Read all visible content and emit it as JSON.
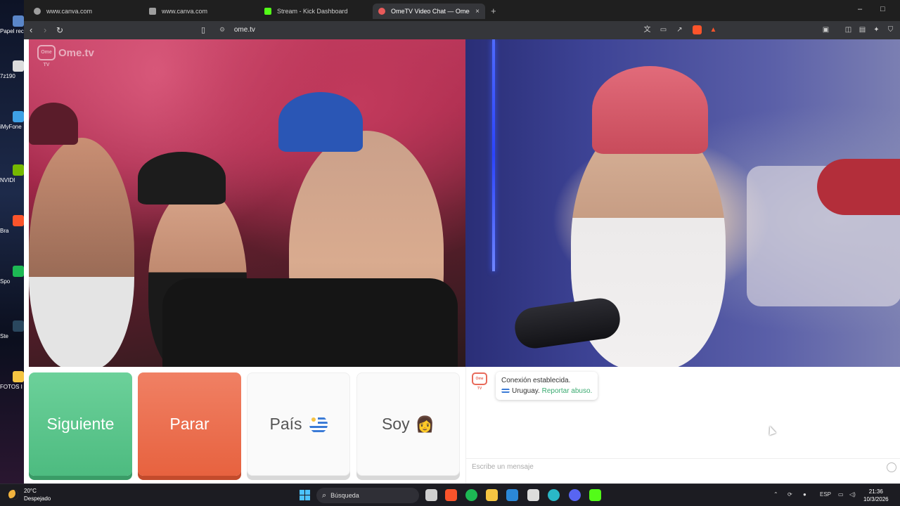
{
  "desktop": {
    "icons": [
      {
        "label": "Papel recic",
        "color": "#5a86c9"
      },
      {
        "label": "7z190",
        "color": "#dcdcdc"
      },
      {
        "label": "iMyFone",
        "color": "#3ea0e5"
      },
      {
        "label": "NVIDI",
        "color": "#76b900"
      },
      {
        "label": "Bra",
        "color": "#fb542b"
      },
      {
        "label": "Spo",
        "color": "#1db954"
      },
      {
        "label": "Ste",
        "color": "#2a475e"
      },
      {
        "label": "FOTOS I",
        "color": "#f5c542"
      }
    ]
  },
  "browser": {
    "tabs": [
      {
        "title": "www.canva.com",
        "favicon_color": "#9e9e9e",
        "active": false
      },
      {
        "title": "www.canva.com",
        "favicon_color": "#9e9e9e",
        "active": false
      },
      {
        "title": "Stream - Kick Dashboard",
        "favicon_color": "#53fc18",
        "active": false
      },
      {
        "title": "OmeTV Video Chat — Omeg",
        "favicon_color": "#e85a5a",
        "active": true
      }
    ],
    "new_tab_symbol": "+",
    "close_symbol": "×",
    "window_controls": {
      "minimize": "–",
      "maximize": "□"
    },
    "url": "ome.tv"
  },
  "ometv": {
    "watermark": "Ome.tv",
    "logo_text": "Ome TV",
    "buttons": {
      "next": "Siguiente",
      "stop": "Parar",
      "country": "País",
      "gender": "Soy"
    },
    "gender_emoji": "👩",
    "chat": {
      "status": "Conexión establecida.",
      "country": "Uruguay.",
      "report_link": "Reportar abuso.",
      "input_placeholder": "Escribe un mensaje"
    },
    "colors": {
      "next": "#4dbb80",
      "stop": "#e7623f",
      "link": "#3aaa70"
    }
  },
  "taskbar": {
    "weather": {
      "temp": "20°C",
      "condition": "Despejado"
    },
    "search_placeholder": "Búsqueda",
    "language": "ESP",
    "time": "21:36",
    "date": "10/3/2026",
    "pinned_apps": [
      {
        "name": "task-view-icon",
        "color": "#cfcfcf"
      },
      {
        "name": "brave-icon",
        "color": "#fb542b"
      },
      {
        "name": "spotify-icon",
        "color": "#1db954"
      },
      {
        "name": "file-explorer-icon",
        "color": "#f5c542"
      },
      {
        "name": "mail-icon",
        "color": "#2b88d8"
      },
      {
        "name": "store-icon",
        "color": "#dcdcdc"
      },
      {
        "name": "edge-icon",
        "color": "#2ab7c6"
      },
      {
        "name": "discord-icon",
        "color": "#5865f2"
      },
      {
        "name": "kick-icon",
        "color": "#53fc18"
      }
    ]
  }
}
